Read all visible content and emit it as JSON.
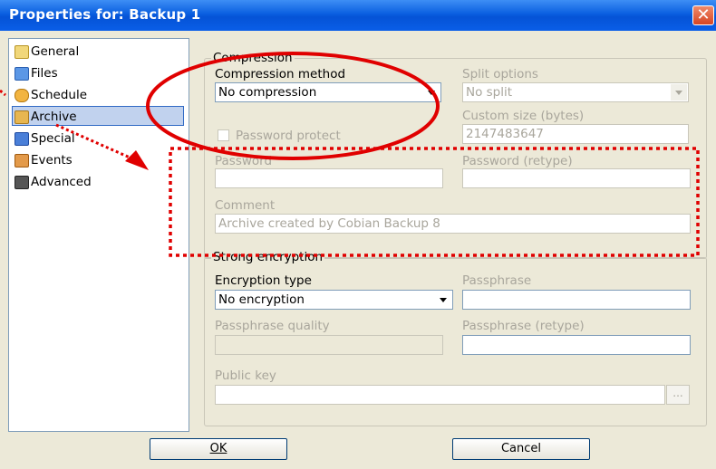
{
  "window": {
    "title": "Properties for: Backup 1"
  },
  "sidebar": {
    "items": [
      {
        "label": "General",
        "color": "#e8c24a"
      },
      {
        "label": "Files",
        "color": "#3f7fd6"
      },
      {
        "label": "Schedule",
        "color": "#e0a030"
      },
      {
        "label": "Archive",
        "color": "#d9a841"
      },
      {
        "label": "Special",
        "color": "#3a6fd0"
      },
      {
        "label": "Events",
        "color": "#d08a3a"
      },
      {
        "label": "Advanced",
        "color": "#444444"
      }
    ],
    "selected": "Archive"
  },
  "compression": {
    "group_title": "Compression",
    "method_label": "Compression method",
    "method_value": "No compression",
    "split_label": "Split options",
    "split_value": "No split",
    "custom_size_label": "Custom size (bytes)",
    "custom_size_value": "2147483647",
    "password_protect_label": "Password protect",
    "password_label": "Password",
    "password_retype_label": "Password (retype)",
    "comment_label": "Comment",
    "comment_value": "Archive created by Cobian Backup 8"
  },
  "encryption": {
    "group_title": "Strong encryption",
    "type_label": "Encryption type",
    "type_value": "No encryption",
    "passphrase_label": "Passphrase",
    "quality_label": "Passphrase quality",
    "passphrase_retype_label": "Passphrase (retype)",
    "public_key_label": "Public key",
    "browse_label": "..."
  },
  "buttons": {
    "ok": "OK",
    "cancel": "Cancel"
  },
  "colors": {
    "annotation": "#e00000",
    "titlebar": "#0a5fe0"
  }
}
